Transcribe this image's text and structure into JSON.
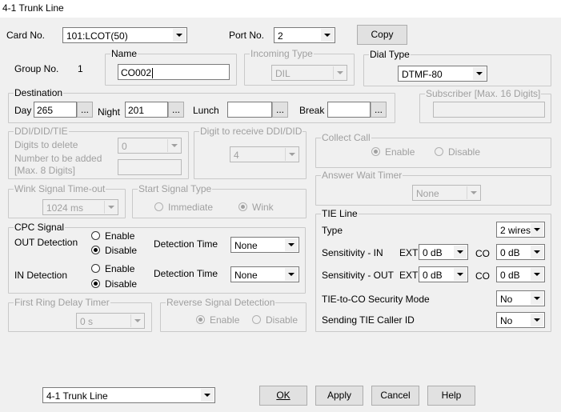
{
  "window": {
    "title": "4-1 Trunk Line"
  },
  "card": {
    "label": "Card No.",
    "value": "101:LCOT(50)"
  },
  "port": {
    "label": "Port No.",
    "value": "2"
  },
  "copy_label": "Copy",
  "group_no": {
    "label": "Group No.",
    "value": "1"
  },
  "name": {
    "title": "Name",
    "value": "CO002"
  },
  "incoming_type": {
    "title": "Incoming Type",
    "value": "DIL"
  },
  "dial_type": {
    "title": "Dial Type",
    "value": "DTMF-80"
  },
  "destination": {
    "title": "Destination",
    "day_label": "Day",
    "day_value": "265",
    "night_label": "Night",
    "night_value": "201",
    "lunch_label": "Lunch",
    "lunch_value": "",
    "break_label": "Break",
    "break_value": "",
    "browse_label": "..."
  },
  "subscriber": {
    "title": "Subscriber [Max. 16 Digits]",
    "value": ""
  },
  "ddi": {
    "title": "DDI/DID/TIE",
    "digits_delete_label": "Digits to delete",
    "digits_delete_value": "0",
    "number_added_label1": "Number to be added",
    "number_added_label2": "[Max. 8 Digits]",
    "number_added_value": ""
  },
  "digit_receive": {
    "title": "Digit to receive DDI/DID",
    "value": "4"
  },
  "collect_call": {
    "title": "Collect Call",
    "enable": "Enable",
    "disable": "Disable",
    "selected": "Enable"
  },
  "wink": {
    "title": "Wink Signal Time-out",
    "value": "1024 ms"
  },
  "start_signal": {
    "title": "Start Signal Type",
    "immediate": "Immediate",
    "wink": "Wink",
    "selected": "Wink"
  },
  "answer_wait": {
    "title": "Answer Wait Timer",
    "value": "None"
  },
  "cpc": {
    "title": "CPC Signal",
    "out_label": "OUT Detection",
    "in_label": "IN Detection",
    "enable": "Enable",
    "disable": "Disable",
    "out_selected": "Disable",
    "in_selected": "Disable",
    "detection_time_label": "Detection Time",
    "out_time": "None",
    "in_time": "None"
  },
  "tie_line": {
    "title": "TIE Line",
    "type_label": "Type",
    "type_value": "2 wires",
    "sens_in_label": "Sensitivity - IN",
    "sens_out_label": "Sensitivity - OUT",
    "ext_label": "EXT",
    "co_label": "CO",
    "in_ext": "0 dB",
    "in_co": "0 dB",
    "out_ext": "0 dB",
    "out_co": "0 dB",
    "security_label": "TIE-to-CO Security Mode",
    "security_value": "No",
    "sending_label": "Sending TIE Caller ID",
    "sending_value": "No"
  },
  "first_ring": {
    "title": "First Ring Delay Timer",
    "value": "0 s"
  },
  "reverse_signal": {
    "title": "Reverse Signal Detection",
    "enable": "Enable",
    "disable": "Disable",
    "selected": "Enable"
  },
  "footer": {
    "screen_select": "4-1 Trunk Line",
    "ok": "OK",
    "apply": "Apply",
    "cancel": "Cancel",
    "help": "Help"
  }
}
